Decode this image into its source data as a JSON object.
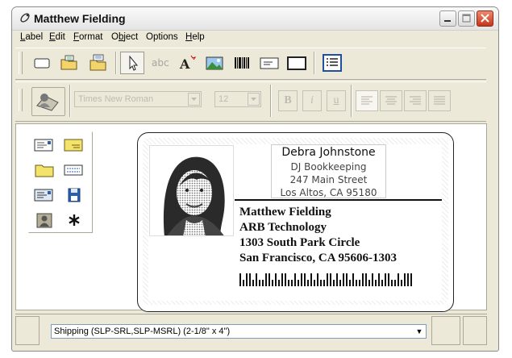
{
  "window": {
    "title": "Matthew Fielding"
  },
  "menu": [
    "Label",
    "Edit",
    "Format",
    "Object",
    "Options",
    "Help"
  ],
  "toolbar": {
    "abc": "abc",
    "font_name": "Times New Roman",
    "font_size": "12",
    "bold": "B",
    "italic": "i",
    "underline": "u"
  },
  "label": {
    "return_address": {
      "name": "Debra Johnstone",
      "line1": "DJ Bookkeeping",
      "line2": "247 Main Street",
      "line3": "Los Altos, CA  95180"
    },
    "address": {
      "line1": "Matthew Fielding",
      "line2": "ARB Technology",
      "line3": "1303 South Park Circle",
      "line4": "San Francisco, CA 95606-1303"
    }
  },
  "status": {
    "label_type": "Shipping (SLP-SRL,SLP-MSRL) (2-1/8\" x 4\")"
  },
  "colors": {
    "accent": "#1f4fa0",
    "close": "#c4361b"
  }
}
